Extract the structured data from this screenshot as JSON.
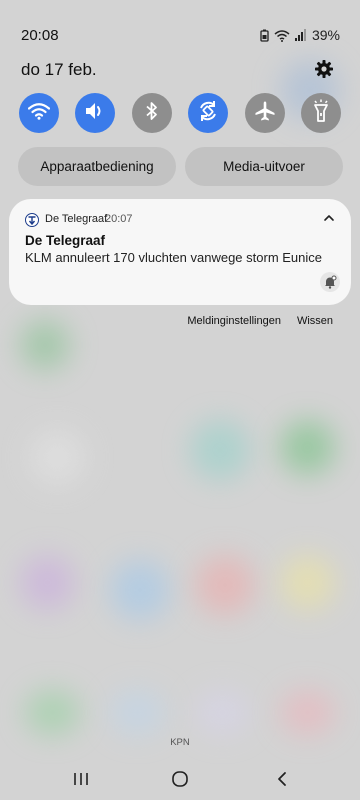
{
  "status_bar": {
    "time": "20:08",
    "battery": "39%",
    "icons": [
      "battery-saver-icon",
      "wifi-icon",
      "signal-icon"
    ]
  },
  "header": {
    "date": "do 17 feb.",
    "settings_icon": "gear-icon"
  },
  "quick_settings": [
    {
      "name": "wifi",
      "icon": "wifi-icon",
      "active": true
    },
    {
      "name": "sound",
      "icon": "volume-icon",
      "active": true
    },
    {
      "name": "bluetooth",
      "icon": "bluetooth-icon",
      "active": false
    },
    {
      "name": "auto-rotate",
      "icon": "rotate-icon",
      "active": true
    },
    {
      "name": "airplane-mode",
      "icon": "airplane-icon",
      "active": false
    },
    {
      "name": "flashlight",
      "icon": "flashlight-icon",
      "active": false
    }
  ],
  "pills": {
    "device_control": "Apparaatbediening",
    "media_output": "Media-uitvoer"
  },
  "notification": {
    "app_name": "De Telegraaf",
    "time": "20:07",
    "title": "De Telegraaf",
    "body": "KLM annuleert 170 vluchten vanwege storm Eunice"
  },
  "notification_actions": {
    "settings": "Meldinginstellingen",
    "clear": "Wissen"
  },
  "carrier": "KPN",
  "colors": {
    "accent": "#3b7bea",
    "tile_off": "#8e8e8e",
    "panel_bg": "#d4d4d4",
    "card_bg": "#f7f7f7"
  }
}
